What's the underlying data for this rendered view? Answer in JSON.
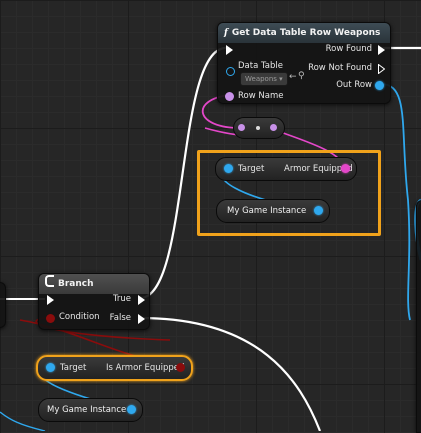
{
  "get_row_node": {
    "title": "Get Data Table Row Weapons",
    "icon": "function-icon",
    "inputs": {
      "data_table_label": "Data Table",
      "data_table_value": "Weapons",
      "row_name_label": "Row Name"
    },
    "outputs": {
      "row_found": "Row Found",
      "row_not_found": "Row Not Found",
      "out_row": "Out Row"
    }
  },
  "selected_group": {
    "armor_equipped_target_label": "Target",
    "armor_equipped_label": "Armor Equipped",
    "game_instance_label": "My Game Instance"
  },
  "branch_node": {
    "title": "Branch",
    "icon": "branch-icon",
    "condition_label": "Condition",
    "true_label": "True",
    "false_label": "False"
  },
  "bottom_nodes": {
    "is_armor_target_label": "Target",
    "is_armor_equipped_label": "Is Armor Equipped",
    "game_instance_label": "My Game Instance"
  },
  "colors": {
    "object_pin": "#2fa8ee",
    "struct_pin": "#e447c9",
    "bool_pin": "#8a0c0c",
    "selection": "#f0a21b"
  }
}
